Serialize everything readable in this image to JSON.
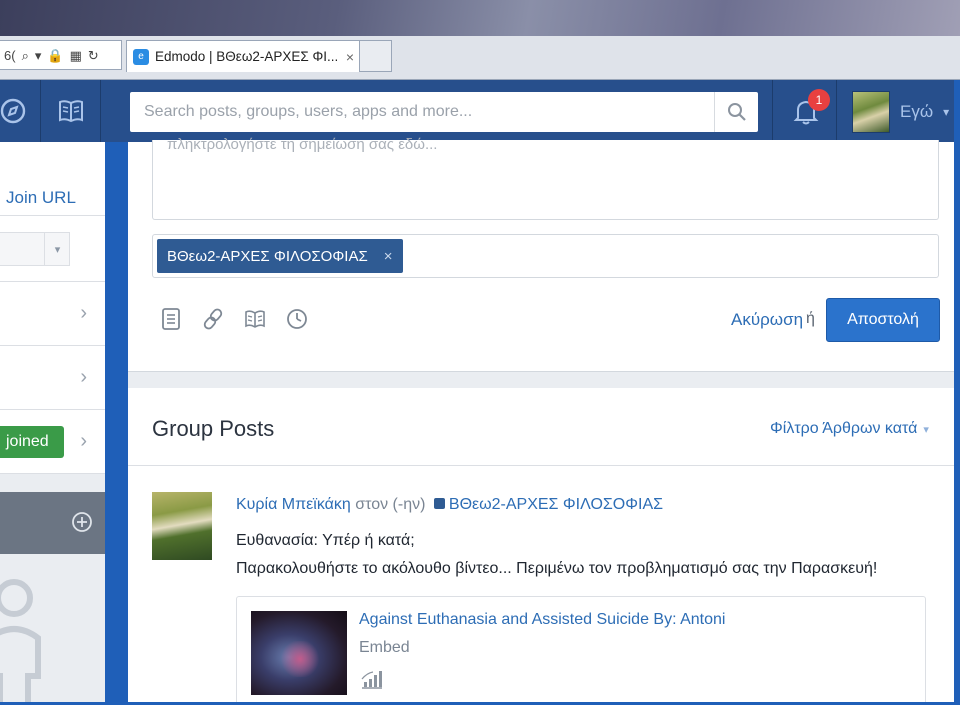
{
  "browser": {
    "address_glyphs": [
      "6(",
      "⌕",
      "▾",
      "🔒",
      "▦",
      "↻"
    ],
    "tab_title": "Edmodo | ΒΘεω2-ΑΡΧΕΣ ΦΙ...",
    "tab_close": "×"
  },
  "topnav": {
    "search_placeholder": "Search posts, groups, users, apps and more...",
    "notification_count": "1",
    "profile_name": "Εγώ",
    "profile_chevron": "▾"
  },
  "sidebar": {
    "join_url_label": "Join URL",
    "select_chevron": "▾",
    "row_chevron": "›",
    "joined_label": "joined"
  },
  "composer": {
    "note_placeholder": "πληκτρολογήστε τη σημείωση σας εδώ...",
    "recipient_chip": "ΒΘεω2-ΑΡΧΕΣ ΦΙΛΟΣΟΦΙΑΣ",
    "chip_remove": "×",
    "cancel_label": "Ακύρωση",
    "or_label": "ή",
    "send_label": "Αποστολή"
  },
  "posts": {
    "title": "Group Posts",
    "filter_label": "Φίλτρο Άρθρων κατά",
    "filter_chevron": "▾",
    "items": [
      {
        "author": "Κυρία Μπεϊκάκη",
        "connector": "στον (-ην)",
        "group": "ΒΘεω2-ΑΡΧΕΣ ΦΙΛΟΣΟΦΙΑΣ",
        "line1": "Ευθανασία: Υπέρ ή κατά;",
        "line2": "Παρακολουθήστε το ακόλουθο βίντεο... Περιμένω τον προβληματισμό σας την Παρασκευή!",
        "embed": {
          "title": "Against Euthanasia and Assisted Suicide By: Antoni",
          "type": "Embed"
        }
      }
    ]
  },
  "colors": {
    "nav_bg": "#274f8c",
    "accent_blue": "#2b73cc",
    "link_blue": "#2d6db5",
    "chip_bg": "#2f5b93",
    "joined_green": "#3a9b48",
    "badge_red": "#e84040"
  }
}
